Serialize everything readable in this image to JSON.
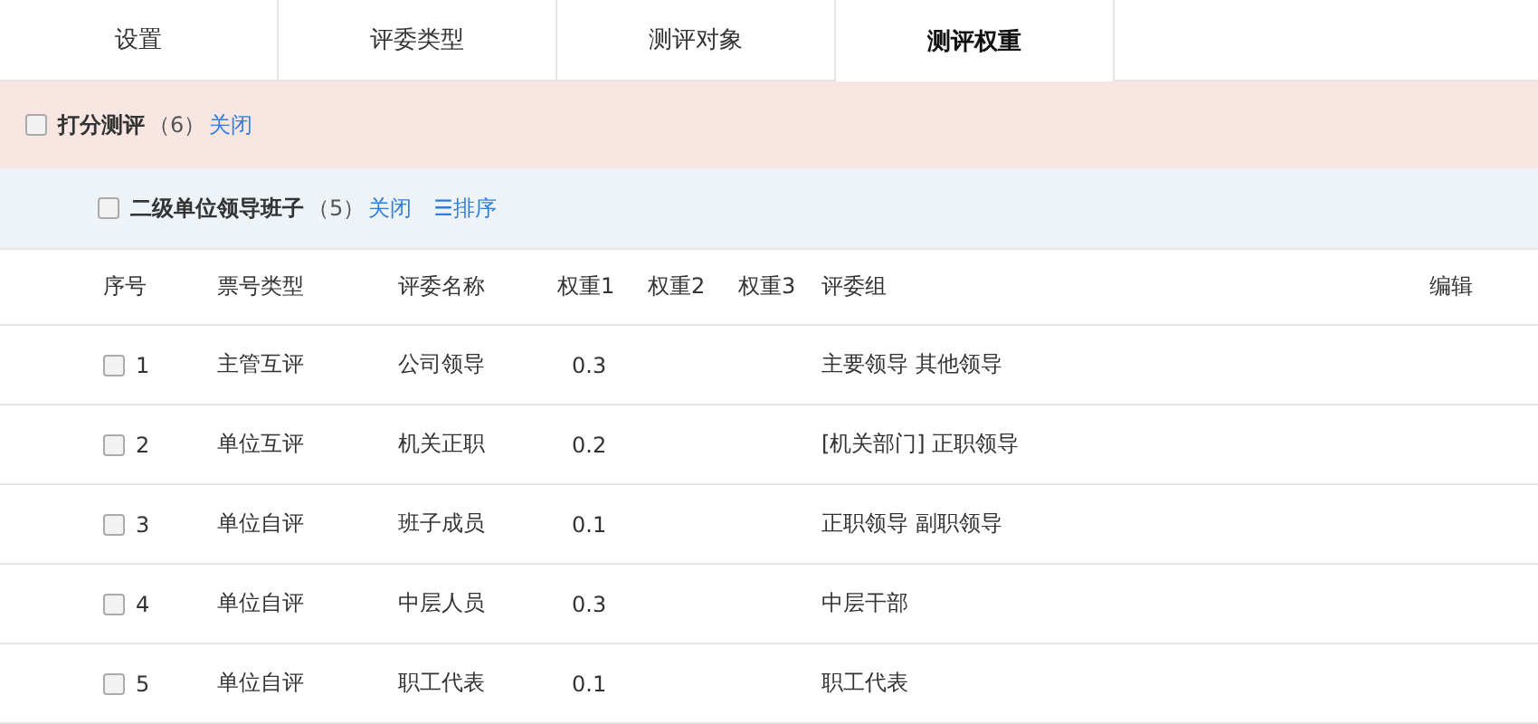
{
  "tabs": [
    {
      "label": "设置",
      "selected": false
    },
    {
      "label": "评委类型",
      "selected": false
    },
    {
      "label": "测评对象",
      "selected": false
    },
    {
      "label": "测评权重",
      "selected": true
    }
  ],
  "group": {
    "title": "打分测评",
    "count": "（6）",
    "checked": false,
    "actions": [
      "关闭"
    ]
  },
  "subgroup": {
    "title": "二级单位领导班子",
    "count": "（5）",
    "checked": false,
    "close": "关闭",
    "sort": "☰排序"
  },
  "table": {
    "columns": [
      "序号",
      "票号类型",
      "评委名称",
      "权重1",
      "权重2",
      "权重3",
      "评委组",
      "编辑"
    ],
    "rows": [
      {
        "checked": false,
        "cells": [
          "1",
          "主管互评",
          "公司领导",
          "0.3",
          "",
          "",
          "主要领导 其他领导"
        ]
      },
      {
        "checked": false,
        "cells": [
          "2",
          "单位互评",
          "机关正职",
          "0.2",
          "",
          "",
          "[机关部门] 正职领导"
        ]
      },
      {
        "checked": false,
        "cells": [
          "3",
          "单位自评",
          "班子成员",
          "0.1",
          "",
          "",
          "正职领导 副职领导"
        ]
      },
      {
        "checked": false,
        "cells": [
          "4",
          "单位自评",
          "中层人员",
          "0.3",
          "",
          "",
          "中层干部"
        ]
      },
      {
        "checked": false,
        "cells": [
          "5",
          "单位自评",
          "职工代表",
          "0.1",
          "",
          "",
          "职工代表"
        ]
      }
    ]
  }
}
